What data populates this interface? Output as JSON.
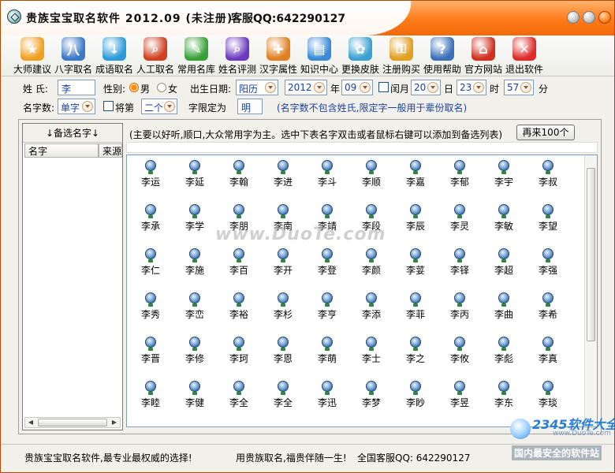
{
  "window": {
    "title": "贵族宝宝取名软件 2012.09 (未注册)",
    "service": "客服QQ:642290127"
  },
  "toolbar": [
    {
      "label": "大师建议",
      "icon": "master-advice-icon",
      "color": "#f0a020",
      "glyph": "★"
    },
    {
      "label": "八字取名",
      "icon": "bazi-icon",
      "color": "#3a78c8",
      "glyph": "八"
    },
    {
      "label": "成语取名",
      "icon": "idiom-download-icon",
      "color": "#2a9ad8",
      "glyph": "↓"
    },
    {
      "label": "人工取名",
      "icon": "manual-search-icon",
      "color": "#d04020",
      "glyph": "⌕"
    },
    {
      "label": "常用名库",
      "icon": "name-library-icon",
      "color": "#38a038",
      "glyph": "✎"
    },
    {
      "label": "姓名评测",
      "icon": "name-evaluate-icon",
      "color": "#6a3ac0",
      "glyph": "⌕"
    },
    {
      "label": "汉字属性",
      "icon": "char-attribute-icon",
      "color": "#e08020",
      "glyph": "✚"
    },
    {
      "label": "知识中心",
      "icon": "knowledge-book-icon",
      "color": "#3a8ad8",
      "glyph": "▤"
    },
    {
      "label": "更换皮肤",
      "icon": "change-skin-icon",
      "color": "#3aa0d0",
      "glyph": "✿"
    },
    {
      "label": "注册购买",
      "icon": "register-lock-icon",
      "color": "#e0a020",
      "glyph": "⚿"
    },
    {
      "label": "使用帮助",
      "icon": "help-icon",
      "color": "#3a70b8",
      "glyph": "?"
    },
    {
      "label": "官方网站",
      "icon": "home-icon",
      "color": "#d03020",
      "glyph": "⌂"
    },
    {
      "label": "退出软件",
      "icon": "exit-icon",
      "color": "#e02a2a",
      "glyph": "✕"
    }
  ],
  "form": {
    "surname_label": "姓  氏:",
    "surname_value": "李",
    "gender_label": "性别:",
    "male_label": "男",
    "female_label": "女",
    "birth_label": "出生日期:",
    "calendar_value": "阳历",
    "year_value": "2012",
    "year_label": "年",
    "month_value": "09",
    "leap_label": "闰月",
    "day_value": "20",
    "day_label": "日",
    "hour_value": "23",
    "hour_label": "时",
    "minute_value": "57",
    "minute_label": "分",
    "count_label": "名字数:",
    "count_value": "单字",
    "generation_label": "将第",
    "generation_value": "二个",
    "fixed_label": "字限定为",
    "fixed_value": "明",
    "hint": "(名字数不包含姓氏,限定字一般用于辈份取名)"
  },
  "left_panel": {
    "header": "↓备选名字↓",
    "col_name": "名字",
    "col_source": "来源"
  },
  "right_panel": {
    "tip": "(主要以好听,顺口,大众常用字为主。选中下表名字双击或者鼠标右键可以添加到备选列表)",
    "more_button": "再来100个",
    "names": [
      [
        "李运",
        "李延",
        "李翰",
        "李进",
        "李斗",
        "李顺",
        "李嘉",
        "李郁",
        "李宇",
        "李叔"
      ],
      [
        "李承",
        "李学",
        "李朋",
        "李南",
        "李靖",
        "李段",
        "李辰",
        "李灵",
        "李敏",
        "李望"
      ],
      [
        "李仁",
        "李施",
        "李百",
        "李开",
        "李登",
        "李颜",
        "李荽",
        "李铎",
        "李超",
        "李强"
      ],
      [
        "李秀",
        "李峦",
        "李裕",
        "李杉",
        "李亨",
        "李添",
        "李菲",
        "李丙",
        "李曲",
        "李希"
      ],
      [
        "李晋",
        "李修",
        "李珂",
        "李恩",
        "李萌",
        "李士",
        "李之",
        "李攸",
        "李彪",
        "李真"
      ],
      [
        "李睦",
        "李健",
        "李全",
        "李全",
        "李迅",
        "李梦",
        "李眇",
        "李昱",
        "李东",
        "李琰"
      ]
    ]
  },
  "status": {
    "left": "贵族宝宝取名软件,最专业最权威的选择!",
    "middle": "用贵族取名,福贵伴随一生!",
    "right": "全国客服QQ: 642290127"
  },
  "watermark": {
    "center": "www.DuoTe.com",
    "brand": "2345软件大全",
    "site": "www.DuoTe.com",
    "slogan": "国内最安全的软件站"
  }
}
